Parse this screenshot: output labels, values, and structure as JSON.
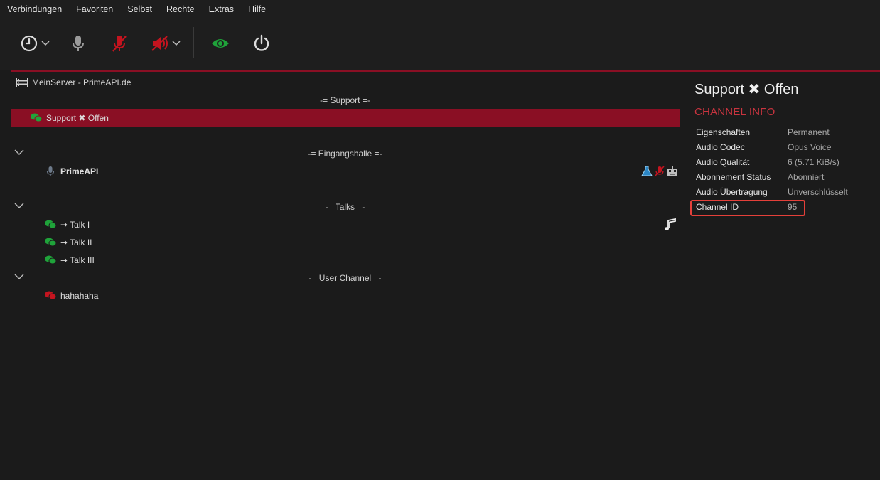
{
  "menu": [
    "Verbindungen",
    "Favoriten",
    "Selbst",
    "Rechte",
    "Extras",
    "Hilfe"
  ],
  "toolbar": {
    "buttons": [
      "history-icon",
      "microphone-icon",
      "microphone-muted-icon",
      "speaker-muted-icon",
      "eye-icon",
      "power-icon"
    ],
    "colors": {
      "muted": "#c4141f",
      "eye": "#1fa33a",
      "neutral": "#dcdcdc"
    }
  },
  "tree": {
    "server": "MeinServer - PrimeAPI.de",
    "spacers": {
      "support": "-= Support =-",
      "eingangshalle": "-= Eingangshalle =-",
      "talks": "-= Talks =-",
      "user_channel": "-= User Channel =-"
    },
    "selected_channel": "Support ✖ Offen",
    "user": "PrimeAPI",
    "talks": [
      "➞ Talk I",
      "➞ Talk II",
      "➞ Talk III"
    ],
    "user_channel": "hahahaha"
  },
  "info": {
    "title": "Support ✖ Offen",
    "section": "CHANNEL INFO",
    "rows": [
      {
        "key": "Eigenschaften",
        "value": "Permanent"
      },
      {
        "key": "Audio Codec",
        "value": "Opus Voice"
      },
      {
        "key": "Audio Qualität",
        "value": "6 (5.71 KiB/s)"
      },
      {
        "key": "Abonnement Status",
        "value": "Abonniert"
      },
      {
        "key": "Audio Übertragung",
        "value": "Unverschlüsselt"
      },
      {
        "key": "Channel ID",
        "value": "95"
      }
    ]
  },
  "colors": {
    "accent": "#8a0f24",
    "info_heading": "#c9343f",
    "highlight_box": "#e4403a",
    "channel_green": "#1fa33a",
    "channel_red": "#c4141f"
  }
}
